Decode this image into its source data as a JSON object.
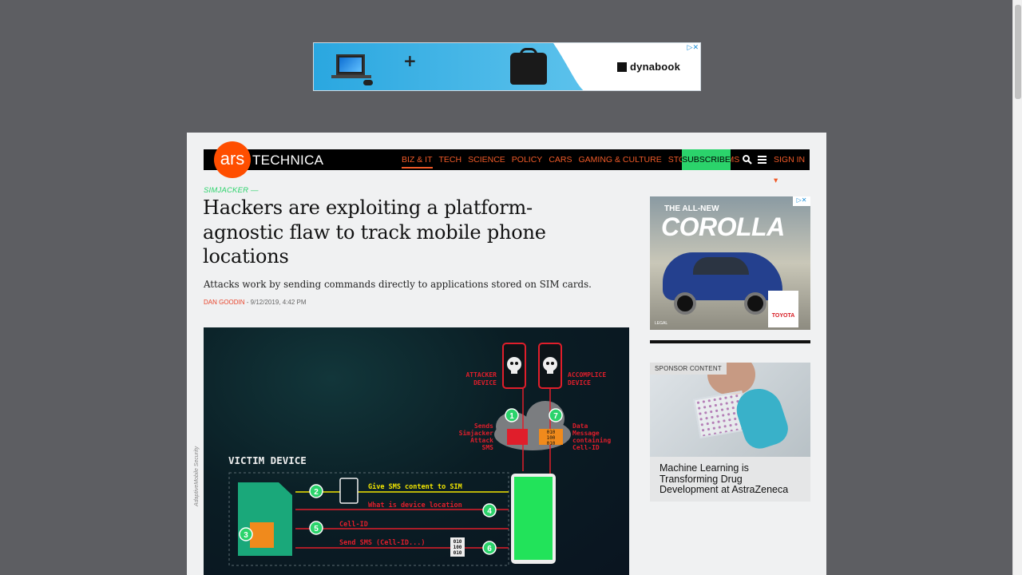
{
  "top_ad": {
    "brand": "dynabook",
    "plus": "+",
    "ad_choices": "▷✕"
  },
  "navbar": {
    "logo_mark": "ars",
    "logo_text": "TECHNICA",
    "links": [
      "BIZ & IT",
      "TECH",
      "SCIENCE",
      "POLICY",
      "CARS",
      "GAMING & CULTURE",
      "STORE",
      "FORUMS"
    ],
    "active_link": "BIZ & IT",
    "subscribe": "SUBSCRIBE",
    "sign_in": "SIGN IN ▾"
  },
  "article": {
    "kicker": "SIMJACKER —",
    "headline": "Hackers are exploiting a platform-agnostic flaw to track mobile phone locations",
    "dek": "Attacks work by sending commands directly to applications stored on SIM cards.",
    "author": "DAN GOODIN",
    "date": " - 9/12/2019, 4:42 PM",
    "image_credit": "AdaptiveMobile Security"
  },
  "diagram": {
    "attacker_label": [
      "ATTACKER",
      "DEVICE"
    ],
    "accomplice_label": [
      "ACCOMPLICE",
      "DEVICE"
    ],
    "sends_label": [
      "Sends",
      "Simjacker",
      "Attack",
      "SMS"
    ],
    "data_label": [
      "Data",
      "Message",
      "containing",
      "Cell-ID"
    ],
    "victim_label": "VICTIM DEVICE",
    "step1": "1",
    "step2": "2",
    "step3": "3",
    "step4": "4",
    "step5": "5",
    "step6": "6",
    "step7": "7",
    "msg_give": "Give SMS content to SIM",
    "msg_where": "What is device location",
    "msg_cellid": "Cell-ID",
    "msg_send": "Send SMS (Cell-ID...)",
    "binary": [
      "010",
      "100",
      "010"
    ],
    "binary2": [
      "010",
      "100",
      "010"
    ],
    "colors": {
      "red": "#e01e2b",
      "green": "#2bd36b",
      "yellow": "#f2e600",
      "orange": "#f08a1c"
    }
  },
  "sidebar": {
    "ad": {
      "line1": "THE ALL-NEW",
      "line2": "COROLLA",
      "brand": "TOYOTA",
      "legal": "LEGAL",
      "ad_choices": "▷✕"
    },
    "sponsor": {
      "tag": "SPONSOR CONTENT",
      "title": "Machine Learning is Transforming Drug Development at AstraZeneca"
    }
  }
}
